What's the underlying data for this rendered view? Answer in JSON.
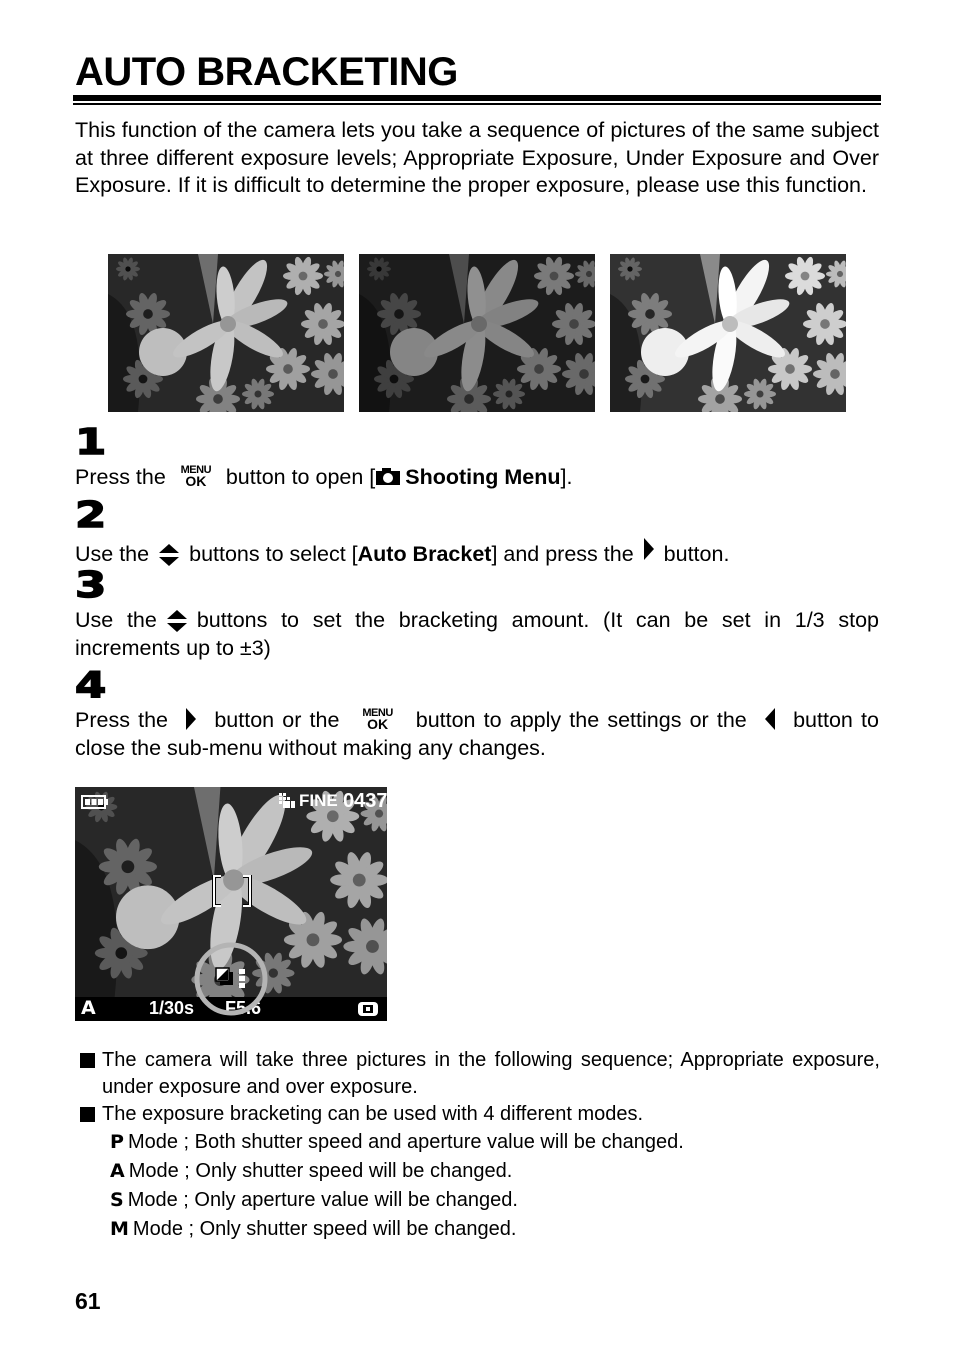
{
  "title": "AUTO BRACKETING",
  "intro": "This function of the camera lets you take a sequence of pictures of the same subject at three different exposure levels; Appropriate Exposure, Under Exposure and Over Exposure. If it is difficult to determine the proper exposure, please use this function.",
  "photos": [
    {
      "label": "Appropriate exposure",
      "brightness": 1.0
    },
    {
      "label": "Under exposure",
      "brightness": 0.7
    },
    {
      "label": "Over exposure",
      "brightness": 1.25
    }
  ],
  "icons": {
    "menu_top": "MENU",
    "menu_bottom": "OK",
    "right_arrow": "▶",
    "left_arrow": "◀"
  },
  "steps": [
    {
      "number": "1",
      "parts": {
        "a": "Press the",
        "b": "button to open [",
        "c": "Shooting Menu",
        "d": "]."
      }
    },
    {
      "number": "2",
      "parts": {
        "a": "Use the",
        "b": "buttons to select [",
        "c": "Auto Bracket",
        "d": "] and press the",
        "e": "button."
      }
    },
    {
      "number": "3",
      "parts": {
        "a": "Use the",
        "b": "buttons to set the bracketing amount. (It can be set in 1/3 stop increments up to ±3)"
      }
    },
    {
      "number": "4",
      "parts": {
        "a": "Press the",
        "b": "button or the",
        "c": "button to apply the settings or the",
        "d": "button to close the sub-menu without making any changes."
      }
    }
  ],
  "lcd": {
    "quality": "FINE",
    "shots_remaining": "0437",
    "mode": "A",
    "shutter": "1/30s",
    "aperture": "F5.6"
  },
  "notes": [
    "The camera will take three pictures in the following sequence; Appropriate exposure, under exposure and over exposure.",
    "The exposure bracketing can be used with 4 different modes."
  ],
  "modes": [
    {
      "letter": "P",
      "text": "Mode ; Both shutter speed and aperture value will be changed."
    },
    {
      "letter": "A",
      "text": "Mode ; Only shutter speed will be changed."
    },
    {
      "letter": "S",
      "text": "Mode ; Only aperture value will be changed."
    },
    {
      "letter": "M",
      "text": "Mode ; Only shutter speed will be changed."
    }
  ],
  "page_number": "61"
}
